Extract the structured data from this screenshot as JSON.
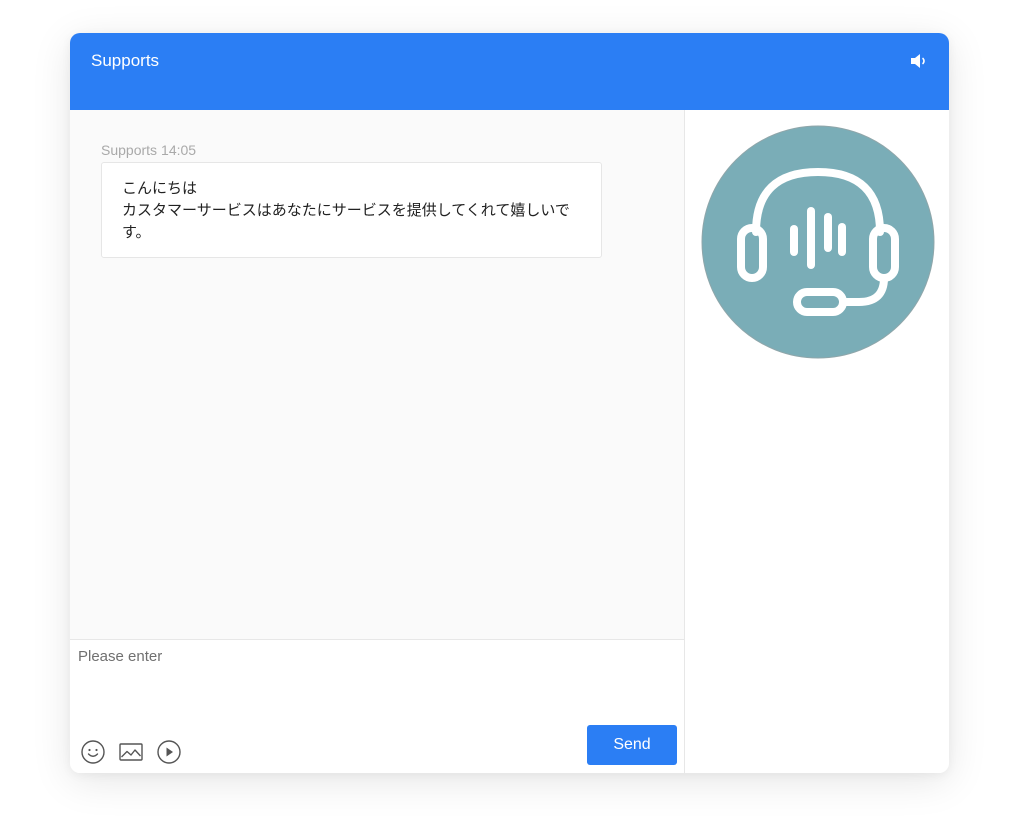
{
  "header": {
    "title": "Supports",
    "sound_icon": "speaker-icon"
  },
  "conversation": {
    "messages": [
      {
        "sender": "Supports",
        "time": "14:05",
        "lines": [
          "こんにちは",
          "カスタマーサービスはあなたにサービスを提供してくれて嬉しいです。"
        ]
      }
    ]
  },
  "composer": {
    "placeholder": "Please enter",
    "value": "",
    "tools": [
      "emoji-icon",
      "image-icon",
      "video-icon"
    ],
    "send_label": "Send"
  },
  "agent": {
    "avatar_icon": "headset-icon"
  },
  "colors": {
    "brand": "#2b7ef4",
    "avatar_bg": "#7aadb7",
    "panel_bg": "#fafafa"
  }
}
